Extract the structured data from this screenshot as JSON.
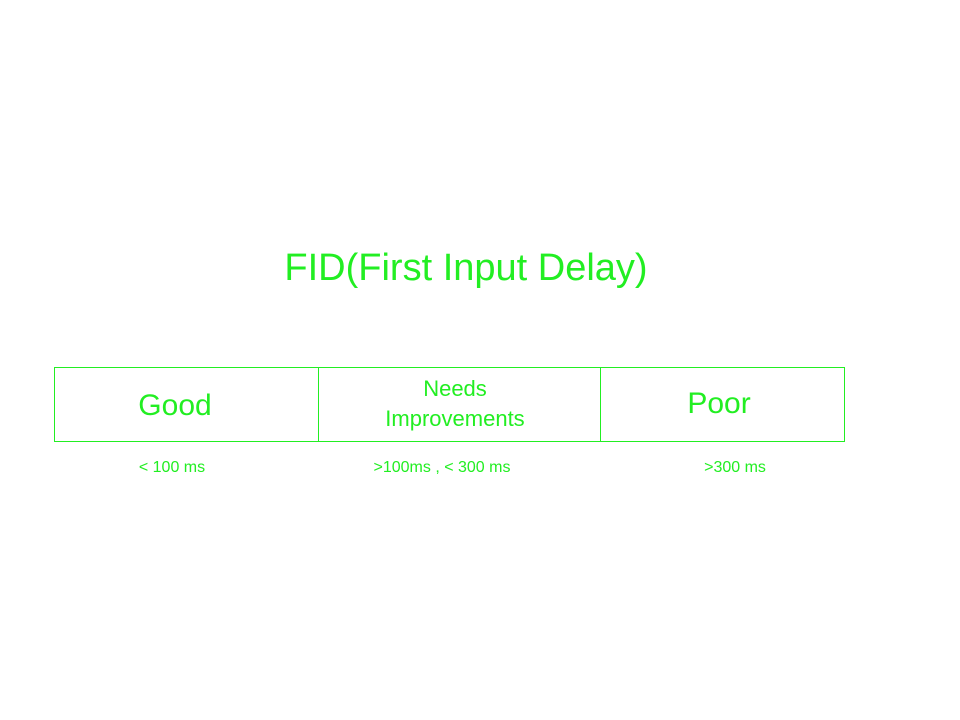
{
  "colors": {
    "accent": "#22ee22",
    "background": "#ffffff"
  },
  "diagram": {
    "title": "FID(First Input Delay)",
    "segments": [
      {
        "label": "Good",
        "range": "< 100 ms"
      },
      {
        "label_line1": "Needs",
        "label_line2": "Improvements",
        "range": ">100ms , < 300 ms"
      },
      {
        "label": "Poor",
        "range": ">300 ms"
      }
    ]
  }
}
